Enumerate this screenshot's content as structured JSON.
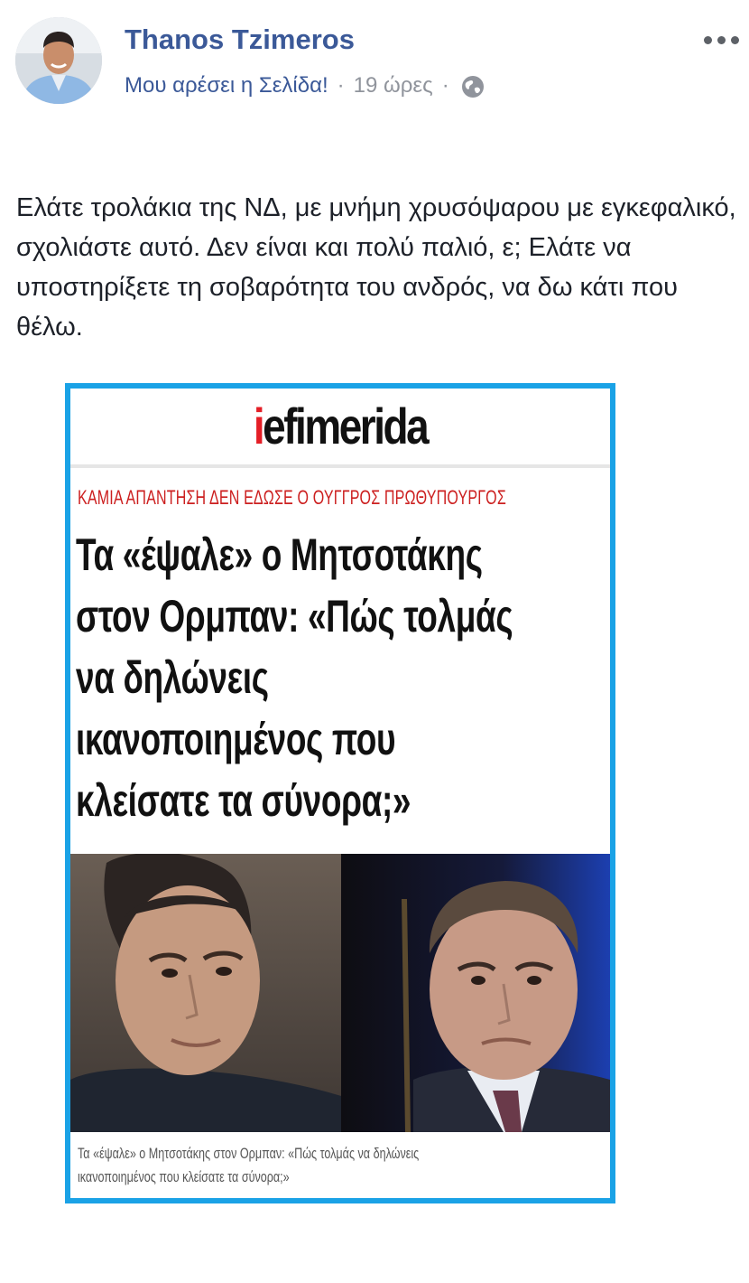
{
  "post": {
    "author": "Thanos Tzimeros",
    "like_page": "Μου αρέσει η Σελίδα!",
    "separator": "·",
    "timestamp": "19 ώρες",
    "privacy_icon": "globe-icon",
    "more_icon": "more-options-icon",
    "text": "Ελάτε τρολάκια της ΝΔ, με μνήμη χρυσόψαρου με εγκεφαλικό, σχολιάστε αυτό. Δεν είναι και πολύ παλιό, ε; Ελάτε να υποστηρίξετε τη σοβαρότητα του ανδρός, να δω κάτι που θέλω."
  },
  "shared_image": {
    "logo_accent": "i",
    "logo_rest": "efimerida",
    "kicker": "ΚΑΜΙΑ ΑΠΑΝΤΗΣΗ ΔΕΝ ΕΔΩΣΕ Ο ΟΥΓΓΡΟΣ ΠΡΩΘΥΠΟΥΡΓΟΣ",
    "headline_lines": [
      "Τα «έψαλε» ο Μητσοτάκης",
      "στον Ορμπαν: «Πώς τολμάς",
      "να δηλώνεις",
      "ικανοποιημένος που",
      "κλείσατε τα σύνορα;»"
    ],
    "caption_lines": [
      "Τα «έψαλε» ο Μητσοτάκης στον Ορμπαν: «Πώς τολμάς να δηλώνεις",
      "ικανοποιημένος που κλείσατε τα σύνορα;»"
    ]
  },
  "colors": {
    "link_blue": "#3b5998",
    "meta_grey": "#90949c",
    "text_dark": "#1d2129",
    "image_frame": "#1aa2e6",
    "logo_red": "#e41e26",
    "kicker_red": "#cc1f1f"
  }
}
